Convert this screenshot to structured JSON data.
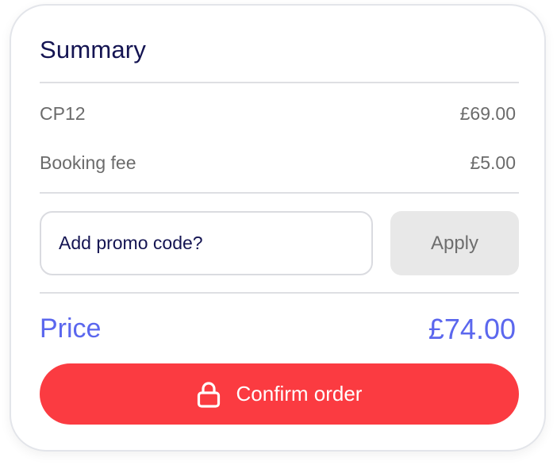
{
  "summary": {
    "title": "Summary",
    "lines": [
      {
        "label": "CP12",
        "value": "£69.00"
      },
      {
        "label": "Booking fee",
        "value": "£5.00"
      }
    ]
  },
  "promo": {
    "placeholder": "Add promo code?",
    "apply_label": "Apply"
  },
  "total": {
    "label": "Price",
    "value": "£74.00"
  },
  "confirm": {
    "label": "Confirm order",
    "icon": "lock-icon"
  },
  "colors": {
    "accent": "#5b67ee",
    "confirm": "#fb3b41",
    "title": "#141452"
  }
}
